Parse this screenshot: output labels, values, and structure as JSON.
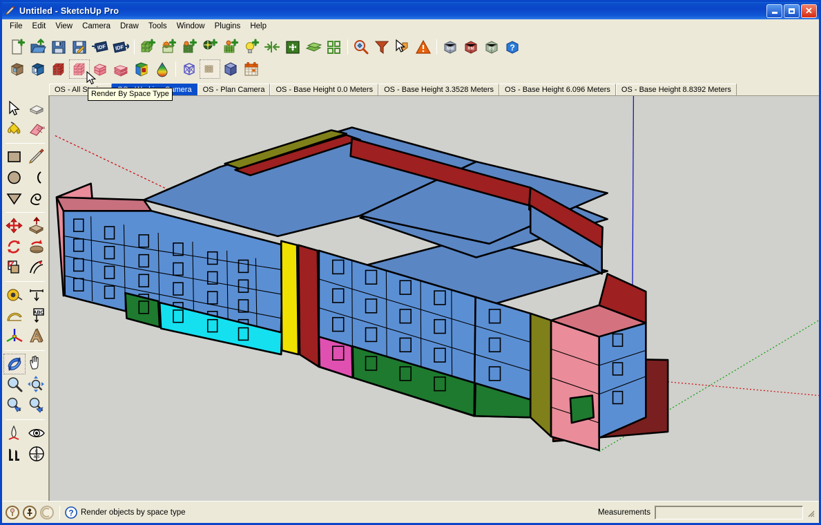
{
  "window": {
    "title": "Untitled - SketchUp Pro",
    "app_icon": "sketchup-pencil-icon",
    "buttons": {
      "minimize": "minimize-button",
      "maximize": "maximize-button",
      "close": "close-button"
    }
  },
  "menubar": {
    "items": [
      "File",
      "Edit",
      "View",
      "Camera",
      "Draw",
      "Tools",
      "Window",
      "Plugins",
      "Help"
    ]
  },
  "toolbars": {
    "row1": [
      {
        "name": "new-openstudio-model-icon",
        "tip": "New OpenStudio Model"
      },
      {
        "name": "open-openstudio-model-icon",
        "tip": "Open OpenStudio Model"
      },
      {
        "name": "save-openstudio-model-icon",
        "tip": "Save OpenStudio Model"
      },
      {
        "name": "save-as-openstudio-model-icon",
        "tip": "Save OpenStudio Model As"
      },
      {
        "name": "import-idf-icon",
        "tip": "Import IDF"
      },
      {
        "name": "export-idf-icon",
        "tip": "Export IDF"
      },
      {
        "separator": true
      },
      {
        "name": "new-space-icon",
        "tip": "New Space"
      },
      {
        "name": "new-shading-surface-group-icon",
        "tip": "New Shading Surface Group"
      },
      {
        "name": "new-interior-partition-group-icon",
        "tip": "New Interior Partition Surface Group"
      },
      {
        "name": "new-daylighting-control-icon",
        "tip": "New Daylighting Control"
      },
      {
        "name": "new-illuminance-map-icon",
        "tip": "New Illuminance Map"
      },
      {
        "name": "new-luminaire-icon",
        "tip": "New Luminaire"
      },
      {
        "name": "surface-matching-icon",
        "tip": "Surface Matching"
      },
      {
        "name": "space-attributes-icon",
        "tip": "Set Attributes for Selected Spaces"
      },
      {
        "name": "project-loose-geometry-icon",
        "tip": "Project Loose Geometry"
      },
      {
        "name": "space-diagram-icon",
        "tip": "Space Diagram"
      },
      {
        "separator": true
      },
      {
        "name": "search-inspector-icon",
        "tip": "Inspector"
      },
      {
        "name": "filter-icon",
        "tip": "Filter"
      },
      {
        "name": "select-object-icon",
        "tip": "Select Object"
      },
      {
        "name": "warnings-icon",
        "tip": "Show Warnings"
      },
      {
        "separator": true
      },
      {
        "name": "model-measure-icon",
        "tip": "MM"
      },
      {
        "name": "render-mode-icon",
        "tip": "RM"
      },
      {
        "name": "render-view-icon",
        "tip": "RV"
      },
      {
        "name": "help-icon",
        "tip": "Help"
      }
    ],
    "row2": [
      {
        "name": "render-by-surface-normal-icon",
        "tip": "Render By Surface Normal"
      },
      {
        "name": "render-by-boundary-condition-icon",
        "tip": "Render By Boundary Condition"
      },
      {
        "name": "render-by-construction-icon",
        "tip": "Render By Construction"
      },
      {
        "name": "render-by-space-type-icon",
        "tip": "Render By Space Type",
        "hovered": true
      },
      {
        "name": "render-by-thermal-zone-icon",
        "tip": "Render By Thermal Zone"
      },
      {
        "name": "render-by-building-story-icon",
        "tip": "Render By Building Story"
      },
      {
        "name": "render-by-layer-icon",
        "tip": "Render By Layer"
      },
      {
        "name": "color-by-value-icon",
        "tip": "Color By Value"
      },
      {
        "separator": true
      },
      {
        "name": "hidden-geometry-icon",
        "tip": "Show/Hide Hidden Geometry"
      },
      {
        "name": "xray-icon",
        "tip": "X-Ray",
        "hovered": true
      },
      {
        "name": "shaded-view-icon",
        "tip": "Shaded With Textures"
      },
      {
        "name": "calendar-icon",
        "tip": "Date and Time"
      }
    ]
  },
  "tooltip": {
    "text": "Render By Space Type"
  },
  "tabs": [
    {
      "label": "OS - All Stories",
      "active": false
    },
    {
      "label": "OS - Working Camera",
      "active": true
    },
    {
      "label": "OS - Plan Camera",
      "active": false
    },
    {
      "label": "OS - Base Height 0.0 Meters",
      "active": false
    },
    {
      "label": "OS - Base Height 3.3528 Meters",
      "active": false
    },
    {
      "label": "OS - Base Height 6.096 Meters",
      "active": false
    },
    {
      "label": "OS - Base Height 8.8392 Meters",
      "active": false
    }
  ],
  "toolpalette": {
    "groups": [
      {
        "items": [
          {
            "name": "select-tool-icon",
            "tip": "Select",
            "active": false
          },
          {
            "name": "make-component-tool-icon",
            "tip": "Make Component"
          },
          {
            "name": "paint-bucket-tool-icon",
            "tip": "Paint Bucket"
          },
          {
            "name": "eraser-tool-icon",
            "tip": "Eraser"
          }
        ]
      },
      {
        "items": [
          {
            "name": "rectangle-tool-icon",
            "tip": "Rectangle"
          },
          {
            "name": "line-tool-icon",
            "tip": "Line"
          },
          {
            "name": "circle-tool-icon",
            "tip": "Circle"
          },
          {
            "name": "arc-tool-icon",
            "tip": "Arc"
          },
          {
            "name": "polygon-tool-icon",
            "tip": "Polygon"
          },
          {
            "name": "freehand-tool-icon",
            "tip": "Freehand"
          }
        ]
      },
      {
        "items": [
          {
            "name": "move-tool-icon",
            "tip": "Move"
          },
          {
            "name": "push-pull-tool-icon",
            "tip": "Push/Pull"
          },
          {
            "name": "rotate-tool-icon",
            "tip": "Rotate"
          },
          {
            "name": "follow-me-tool-icon",
            "tip": "Follow Me"
          },
          {
            "name": "scale-tool-icon",
            "tip": "Scale"
          },
          {
            "name": "offset-tool-icon",
            "tip": "Offset"
          }
        ]
      },
      {
        "items": [
          {
            "name": "tape-measure-tool-icon",
            "tip": "Tape Measure"
          },
          {
            "name": "dimension-tool-icon",
            "tip": "Dimension"
          },
          {
            "name": "protractor-tool-icon",
            "tip": "Protractor"
          },
          {
            "name": "text-tool-icon",
            "tip": "Text"
          },
          {
            "name": "axes-tool-icon",
            "tip": "Axes"
          },
          {
            "name": "3d-text-tool-icon",
            "tip": "3D Text"
          }
        ]
      },
      {
        "items": [
          {
            "name": "orbit-tool-icon",
            "tip": "Orbit",
            "active": true
          },
          {
            "name": "pan-tool-icon",
            "tip": "Pan"
          },
          {
            "name": "zoom-tool-icon",
            "tip": "Zoom"
          },
          {
            "name": "zoom-window-tool-icon",
            "tip": "Zoom Window"
          },
          {
            "name": "zoom-extents-tool-icon",
            "tip": "Zoom Extents"
          },
          {
            "name": "previous-view-tool-icon",
            "tip": "Previous View"
          }
        ]
      },
      {
        "items": [
          {
            "name": "position-camera-tool-icon",
            "tip": "Position Camera"
          },
          {
            "name": "look-around-tool-icon",
            "tip": "Look Around"
          },
          {
            "name": "walk-tool-icon",
            "tip": "Walk"
          },
          {
            "name": "section-plane-tool-icon",
            "tip": "Section Plane"
          }
        ]
      }
    ]
  },
  "statusbar": {
    "circles": [
      "status-circle-1",
      "status-circle-2",
      "status-circle-3"
    ],
    "help_icon": "question-mark-icon",
    "help_text": "Render objects by space type",
    "measurements_label": "Measurements",
    "measurements_value": "",
    "resize_grip": "resize-grip-icon"
  },
  "viewport": {
    "background_color": "#d0d0cc",
    "cursor": "orbit-cursor",
    "axes": {
      "red_axis_color": "#cc0000",
      "green_axis_color": "#00a000",
      "blue_axis_color": "#0000cc"
    },
    "space_type_colors": {
      "office_blue": "#5b8fd4",
      "corridor_green": "#1e7a2e",
      "lobby_pink": "#ea8c9a",
      "restroom_cyan": "#14e0f0",
      "stairs_yellow": "#f0e000",
      "mechanical_darkred": "#9e2020",
      "storage_olive": "#80801a",
      "electrical_magenta": "#e050b0",
      "ground_slab": "#7a1f1f",
      "roof_blue": "#5b86c4"
    }
  }
}
